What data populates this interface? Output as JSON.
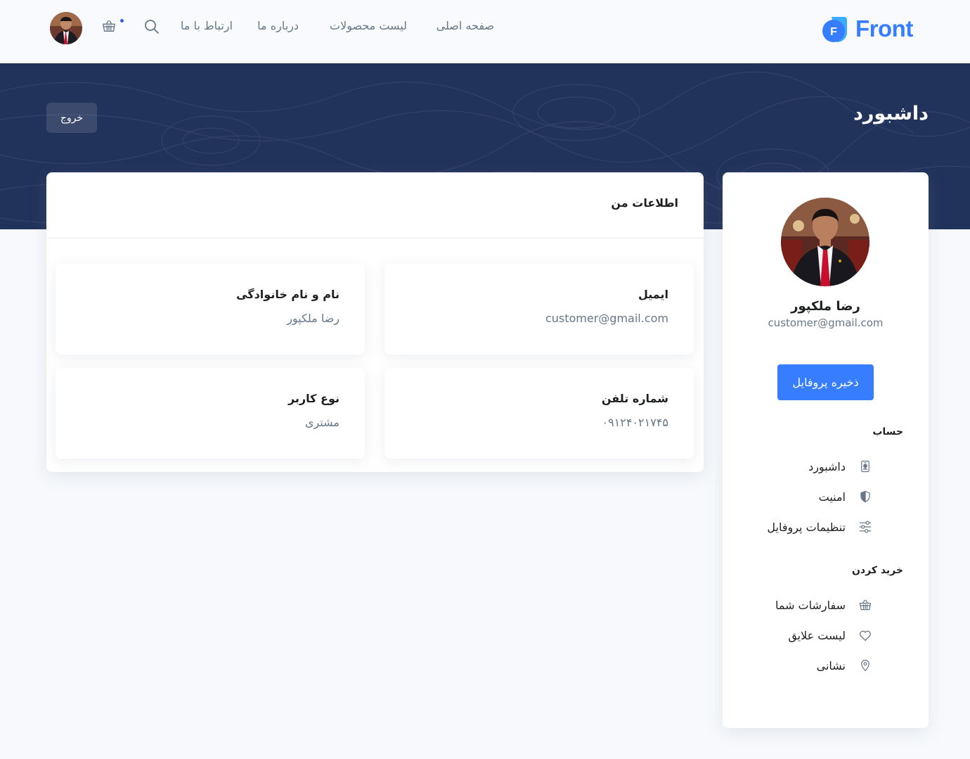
{
  "brand": {
    "name": "Front",
    "logo_letter": "F",
    "color": "#377dff"
  },
  "nav": {
    "home": "صفحه اصلی",
    "products": "لیست محصولات",
    "about": "درباره ما",
    "contact": "ارتباط با ما"
  },
  "hero": {
    "title": "داشبورد",
    "logout": "خروج"
  },
  "profile": {
    "name": "رضا ملکپور",
    "email": "customer@gmail.com",
    "save_button": "ذخیره پروفایل"
  },
  "sidebar": {
    "account_heading": "حساب",
    "account_items": [
      {
        "label": "داشبورد",
        "icon": "id-badge-icon"
      },
      {
        "label": "امنیت",
        "icon": "shield-icon"
      },
      {
        "label": "تنظیمات پروفایل",
        "icon": "sliders-icon"
      }
    ],
    "shopping_heading": "خرید کردن",
    "shopping_items": [
      {
        "label": "سفارشات شما",
        "icon": "basket-icon"
      },
      {
        "label": "لیست علایق",
        "icon": "heart-icon"
      },
      {
        "label": "نشانی",
        "icon": "map-pin-icon"
      }
    ]
  },
  "main": {
    "title": "اطلاعات من",
    "fields": {
      "email": {
        "label": "ایمیل",
        "value": "customer@gmail.com"
      },
      "full_name": {
        "label": "نام و نام خانوادگی",
        "value": "رضا ملکپور"
      },
      "phone": {
        "label": "شماره تلفن",
        "value": "۰۹۱۲۴۰۲۱۷۴۵"
      },
      "user_type": {
        "label": "نوع کاربر",
        "value": "مشتری"
      }
    }
  },
  "colors": {
    "hero_bg": "#21325b",
    "primary": "#377dff",
    "text_muted": "#677788",
    "page_bg": "#f7f9fc"
  }
}
